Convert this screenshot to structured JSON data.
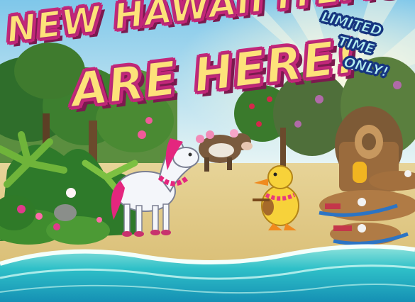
{
  "banner": {
    "headline_line1": "NEW HAWAII ITEMS",
    "headline_line2": "ARE HERE!",
    "badge_line1": "LIMITED",
    "badge_line2": "TIME",
    "badge_line3": "ONLY!"
  },
  "colors": {
    "headline_fill": "#fde27a",
    "headline_outline": "#c4267a",
    "badge_fill": "#b6f0ee",
    "badge_outline": "#16357d",
    "sand": "#dcc47e",
    "ocean": "#2fc0c8"
  },
  "scene_objects": [
    "jungle-trees",
    "white-pony-with-lei",
    "brown-cow-with-flowers",
    "yellow-duck-with-ukulele",
    "tiki-hut-with-decks",
    "ocean-shoreline"
  ]
}
